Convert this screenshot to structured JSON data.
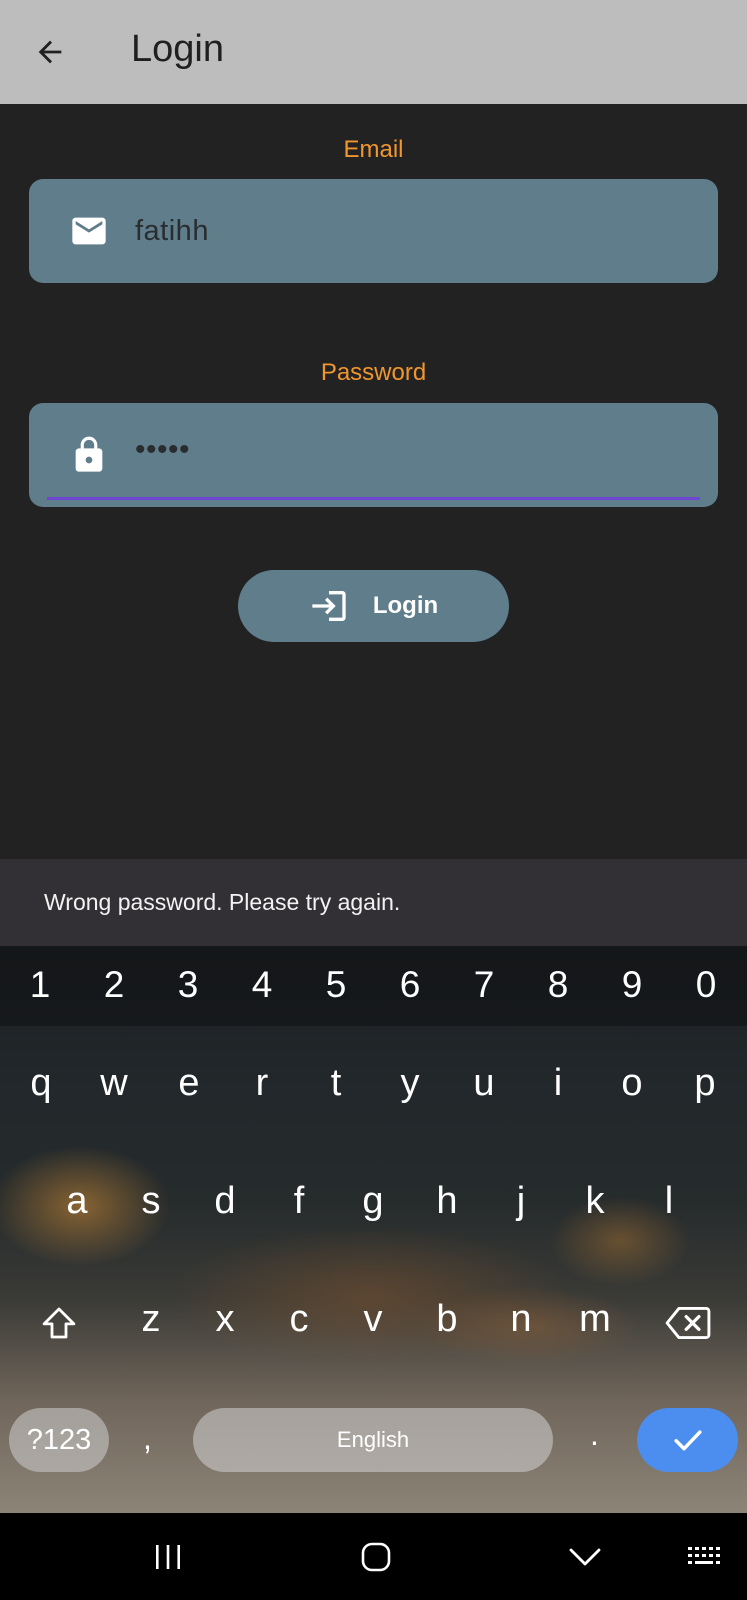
{
  "app_bar": {
    "back_icon": "arrow-back-icon",
    "title": "Login"
  },
  "form": {
    "email": {
      "label": "Email",
      "icon": "mail-icon",
      "value": "fatihh"
    },
    "password": {
      "label": "Password",
      "icon": "lock-icon",
      "value": "•••••"
    },
    "login_button": {
      "icon": "login-icon",
      "label": "Login"
    }
  },
  "snackbar": {
    "message": "Wrong password. Please try again."
  },
  "keyboard": {
    "number_row": [
      "1",
      "2",
      "3",
      "4",
      "5",
      "6",
      "7",
      "8",
      "9",
      "0"
    ],
    "row1": [
      "q",
      "w",
      "e",
      "r",
      "t",
      "y",
      "u",
      "i",
      "o",
      "p"
    ],
    "row2": [
      "a",
      "s",
      "d",
      "f",
      "g",
      "h",
      "j",
      "k",
      "l"
    ],
    "row3": [
      "z",
      "x",
      "c",
      "v",
      "b",
      "n",
      "m"
    ],
    "shift_icon": "shift-icon",
    "backspace_icon": "backspace-icon",
    "symbols_label": "?123",
    "comma": ",",
    "space_label": "English",
    "period": ".",
    "enter_icon": "check-icon"
  },
  "colors": {
    "app_bar": "#bdbdbd",
    "background": "#222223",
    "field": "#607d8b",
    "label_accent": "#f0962c",
    "focus_underline": "#6e46d2",
    "snackbar": "#323034",
    "enter_key": "#4b8ef0"
  },
  "nav_bar": {
    "recents_icon": "recents-icon",
    "home_icon": "home-icon",
    "hide_keyboard_icon": "chevron-down-icon",
    "keyboard_switch_icon": "keyboard-icon"
  }
}
